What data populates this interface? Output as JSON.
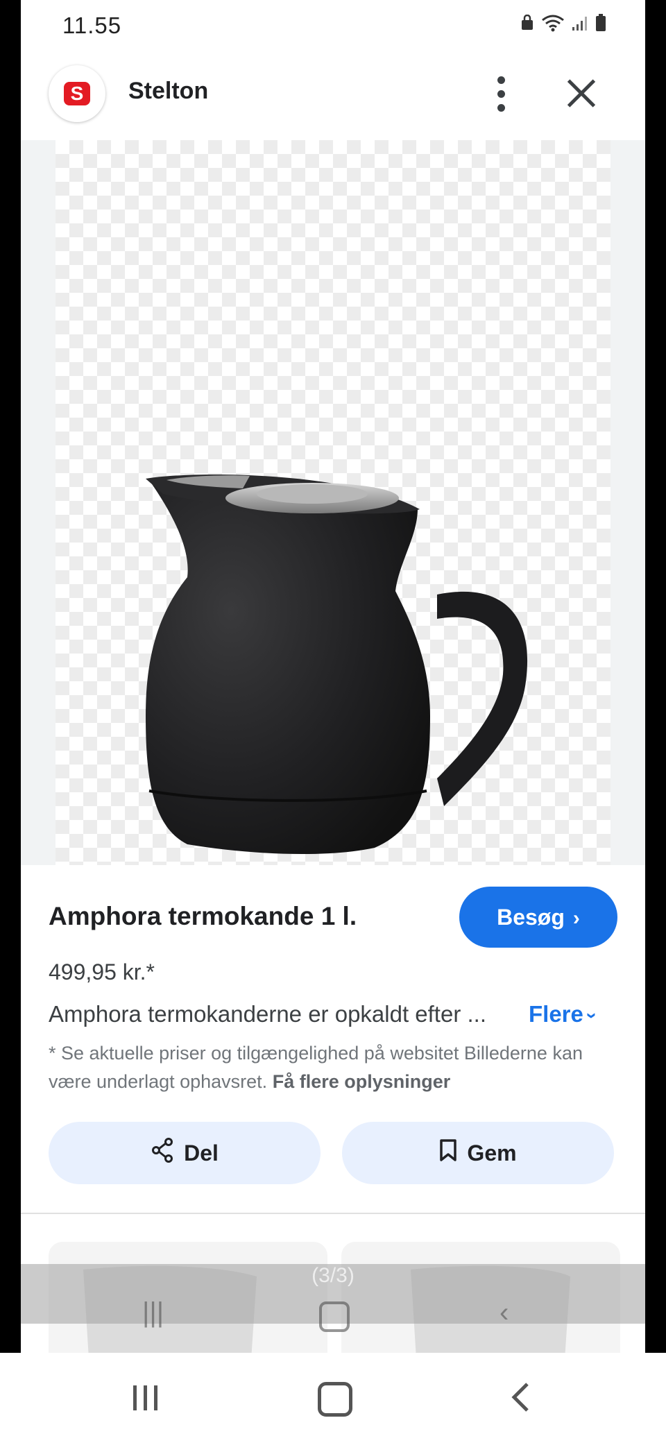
{
  "status_bar": {
    "time": "11.55"
  },
  "header": {
    "site_name": "Stelton",
    "logo_letter": "S"
  },
  "product": {
    "title": "Amphora termokande 1 l.",
    "visit_label": "Besøg",
    "price": "499,95 kr.*",
    "description": "Amphora termokanderne er opkaldt efter ...",
    "more_label": "Flere",
    "disclaimer": "* Se aktuelle priser og tilgængelighed på websitet Billederne kan være underlagt ophavsret.",
    "disclaimer_link": "Få flere oplysninger"
  },
  "actions": {
    "share_label": "Del",
    "save_label": "Gem"
  },
  "gallery": {
    "counter": "(3/3)"
  },
  "colors": {
    "accent": "#1a73e8",
    "logo": "#e31b23",
    "chip_bg": "#e8f0fe"
  },
  "icons": [
    "wifi-icon",
    "signal-icon",
    "battery-icon",
    "more-vert-icon",
    "close-icon",
    "chevron-right-icon",
    "chevron-down-icon",
    "share-icon",
    "bookmark-icon",
    "nav-recent-icon",
    "nav-home-icon",
    "nav-back-icon"
  ]
}
